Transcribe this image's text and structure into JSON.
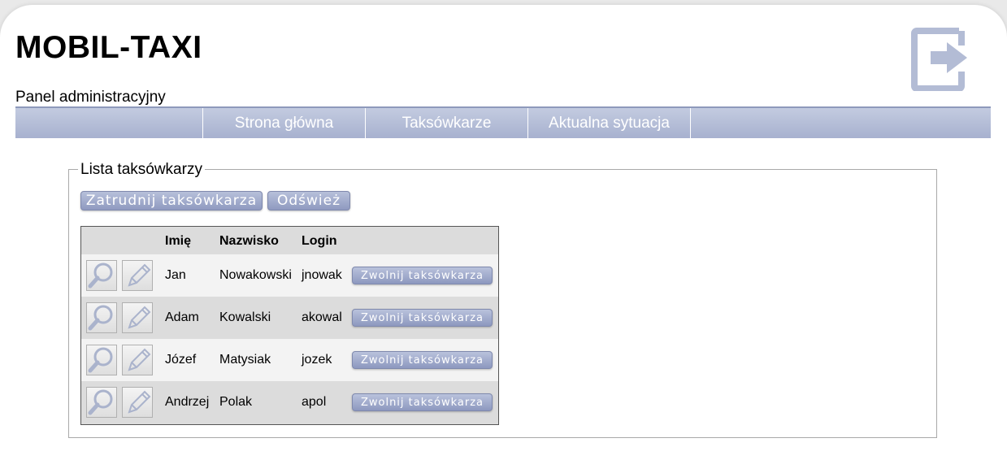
{
  "header": {
    "title": "MOBIL-TAXI",
    "subtitle": "Panel administracyjny",
    "logout_icon": "logout-icon"
  },
  "nav": {
    "items": [
      {
        "label": "Strona główna"
      },
      {
        "label": "Taksówkarze"
      },
      {
        "label": "Aktualna sytuacja"
      }
    ]
  },
  "panel": {
    "legend": "Lista taksówkarzy",
    "hire_label": "Zatrudnij taksówkarza",
    "refresh_label": "Odśwież"
  },
  "table": {
    "columns": [
      "Imię",
      "Nazwisko",
      "Login"
    ],
    "fire_label": "Zwolnij taksówkarza",
    "rows": [
      {
        "first": "Jan",
        "last": "Nowakowski",
        "login": "jnowak"
      },
      {
        "first": "Adam",
        "last": "Kowalski",
        "login": "akowal"
      },
      {
        "first": "Józef",
        "last": "Matysiak",
        "login": "jozek"
      },
      {
        "first": "Andrzej",
        "last": "Polak",
        "login": "apol"
      }
    ]
  },
  "colors": {
    "accent": "#a7b1cf",
    "nav_border": "#8e99bb"
  }
}
